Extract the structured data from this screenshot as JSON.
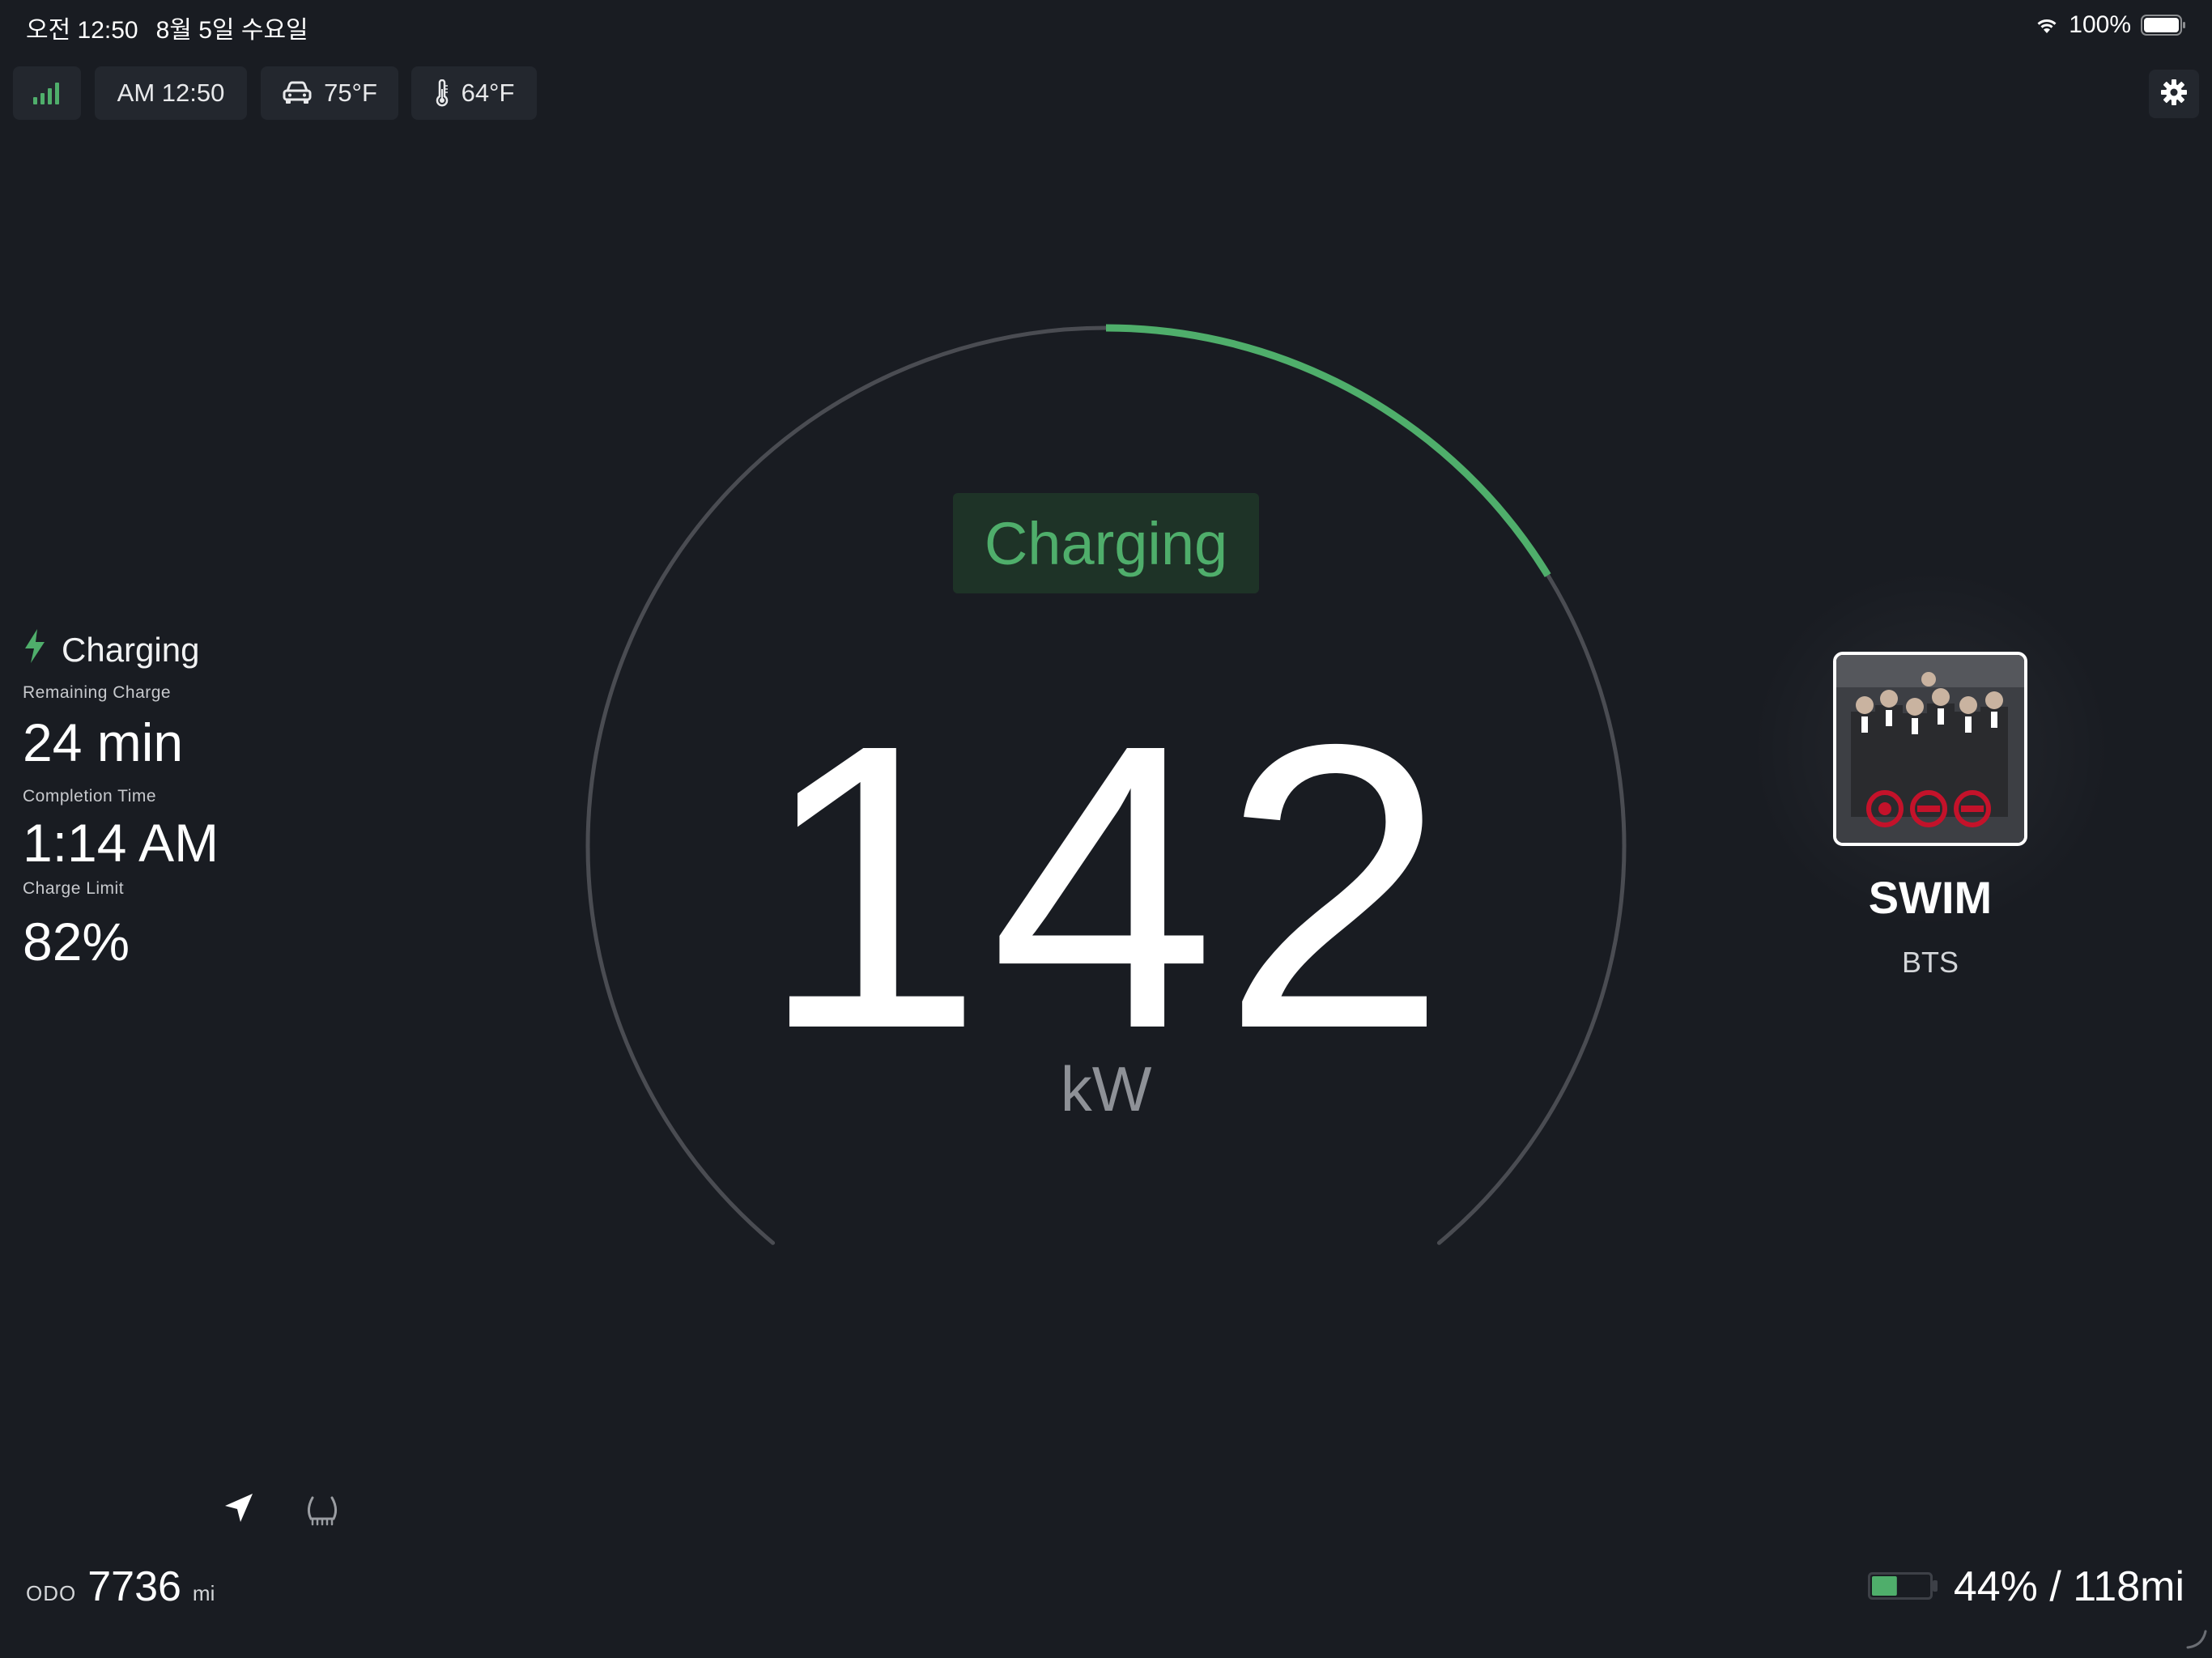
{
  "status_bar": {
    "time": "오전 12:50",
    "date": "8월 5일 수요일",
    "battery_percent": "100%",
    "icons": [
      "wifi-icon",
      "battery-icon"
    ]
  },
  "top_bar": {
    "signal_icon": "cellular-signal-icon",
    "clock": "AM 12:50",
    "cabin_temp": "75°F",
    "outside_temp": "64°F",
    "settings_icon": "gear-icon"
  },
  "charging_panel": {
    "title": "Charging",
    "remaining_label": "Remaining Charge",
    "remaining_value": "24 min",
    "completion_label": "Completion Time",
    "completion_value": "1:14 AM",
    "limit_label": "Charge Limit",
    "limit_value": "82%"
  },
  "gauge": {
    "status": "Charging",
    "power": "142",
    "unit": "kW",
    "arc_fill_fraction": 0.25,
    "accent_color": "#4fae6b",
    "track_color": "#4a4c52"
  },
  "music": {
    "title": "SWIM",
    "artist": "BTS"
  },
  "bottom": {
    "odo_label": "ODO",
    "odo_value": "7736",
    "odo_unit": "mi",
    "battery_text": "44% / 118mi",
    "battery_level": 0.44,
    "icons": [
      "navigation-arrow-icon",
      "tire-pressure-icon"
    ]
  },
  "colors": {
    "background": "#191c22",
    "panel": "#23272e",
    "accent": "#4fae6b"
  }
}
